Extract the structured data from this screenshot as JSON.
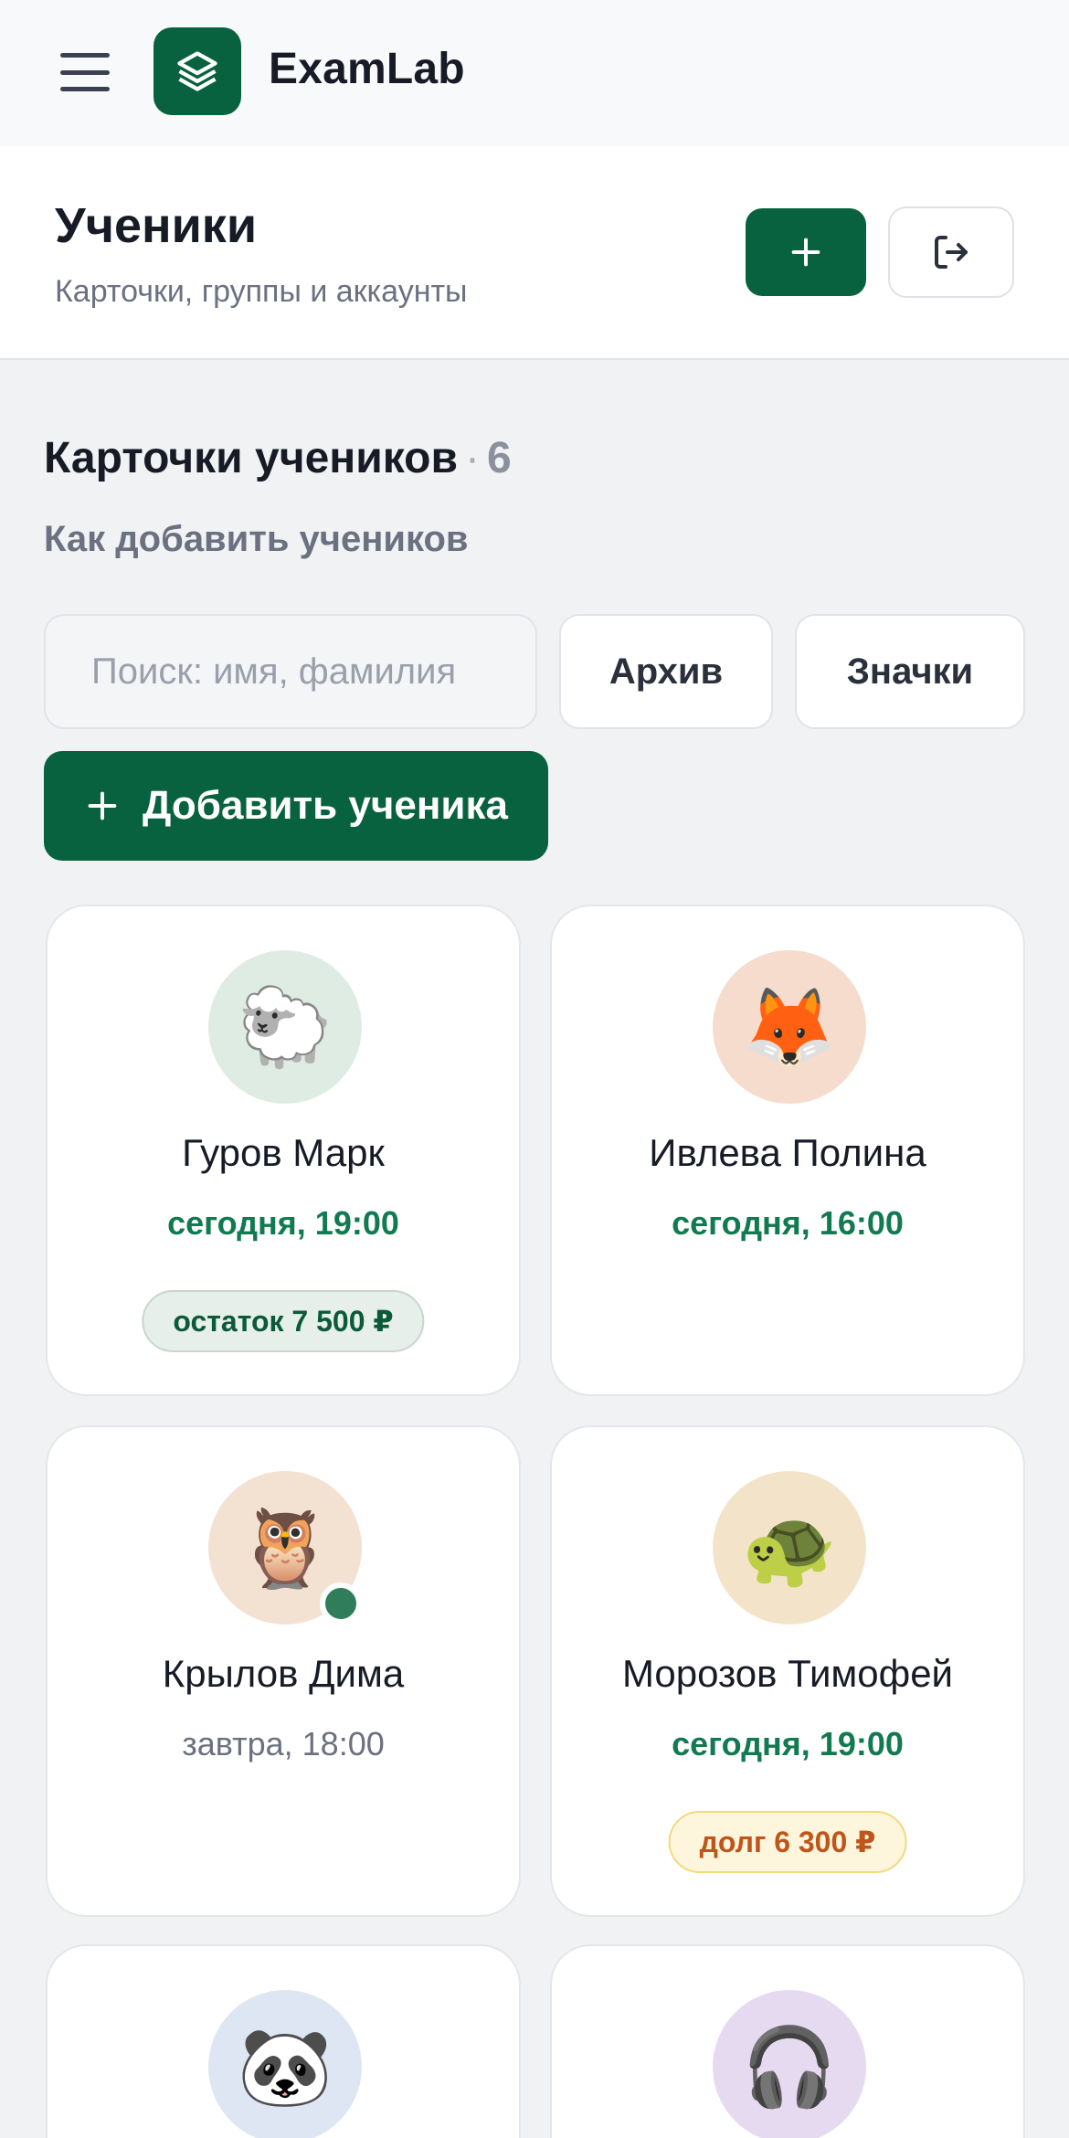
{
  "app": {
    "name": "ExamLab"
  },
  "header": {
    "title": "Ученики",
    "subtitle": "Карточки, группы и аккаунты"
  },
  "section": {
    "title": "Карточки учеников",
    "separator": "·",
    "count": "6",
    "howto_link": "Как добавить учеников"
  },
  "search": {
    "placeholder": "Поиск: имя, фамилия"
  },
  "filters": {
    "archive_label": "Архив",
    "badges_label": "Значки"
  },
  "add_student_label": "Добавить ученика",
  "students": [
    {
      "name": "Гуров Марк",
      "time": "сегодня, 19:00",
      "avatar": "🐑",
      "avatar_bg": "#dfece4",
      "badge": "остаток 7 500 ₽",
      "badge_type": "ok",
      "online": false
    },
    {
      "name": "Ивлева Полина",
      "time": "сегодня, 16:00",
      "avatar": "🦊",
      "avatar_bg": "#f6dccc",
      "badge": "",
      "badge_type": "",
      "online": false
    },
    {
      "name": "Крылов Дима",
      "time": "завтра, 18:00",
      "avatar": "🦉",
      "avatar_bg": "#f3e1d2",
      "badge": "",
      "badge_type": "",
      "online": true,
      "time_muted": true
    },
    {
      "name": "Морозов Тимофей",
      "time": "сегодня, 19:00",
      "avatar": "🐢",
      "avatar_bg": "#f3e4c9",
      "badge": "долг 6 300 ₽",
      "badge_type": "debt",
      "online": false
    },
    {
      "name": "",
      "time": "",
      "avatar": "🐼",
      "avatar_bg": "#dde6f2",
      "badge": "",
      "badge_type": "",
      "online": false
    },
    {
      "name": "",
      "time": "",
      "avatar": "🎧",
      "avatar_bg": "#e6daf0",
      "badge": "",
      "badge_type": "",
      "online": false
    }
  ],
  "colors": {
    "brand": "#08623f",
    "positive_text": "#117a50",
    "debt_text": "#c0541a"
  }
}
